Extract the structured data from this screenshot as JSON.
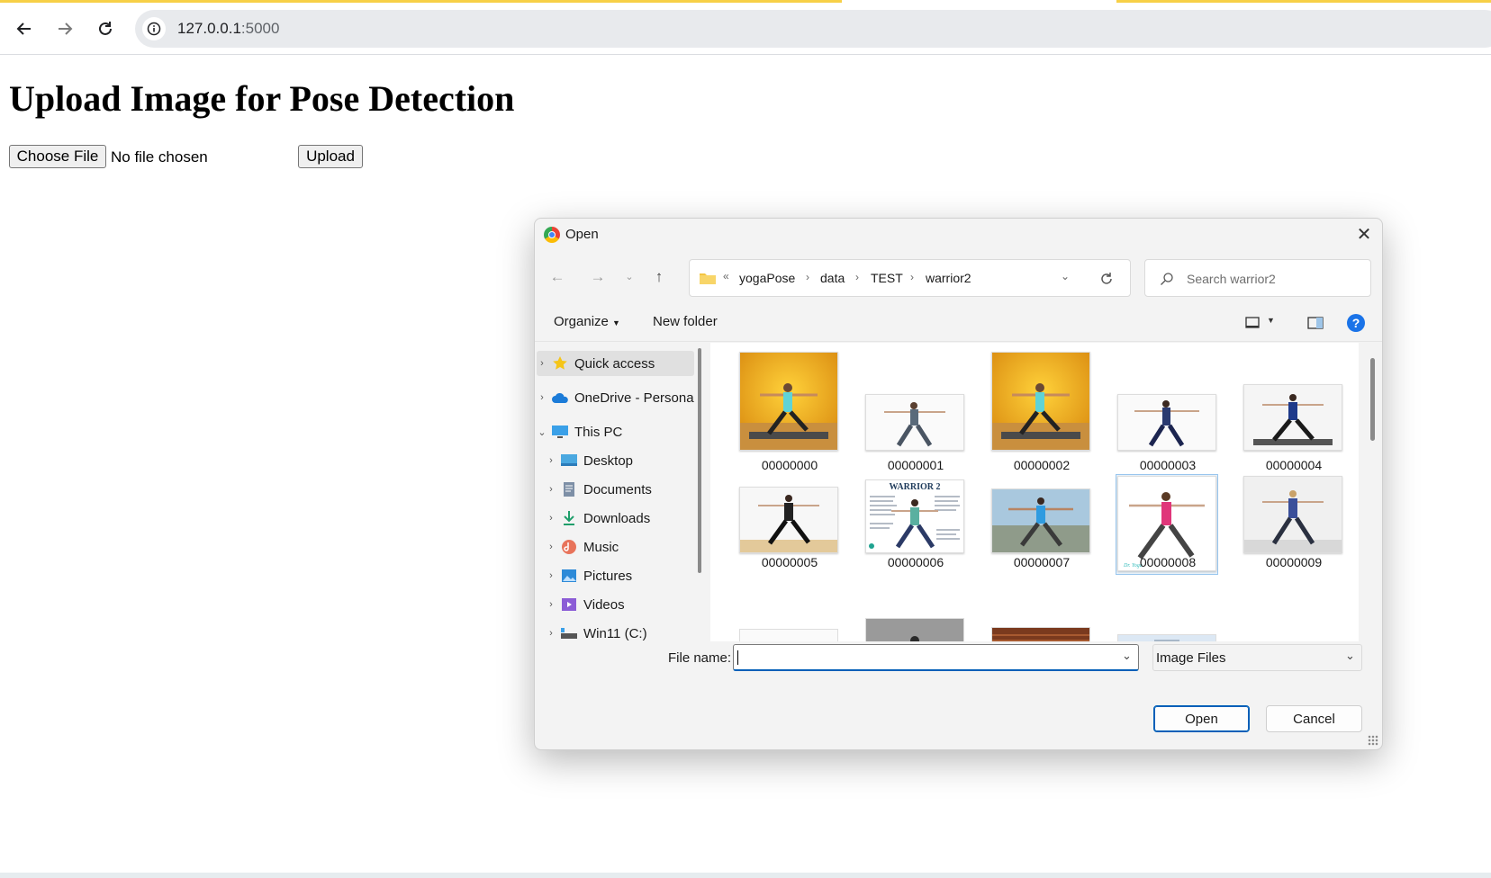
{
  "browser": {
    "url_host": "127.0.0.1",
    "url_port": ":5000",
    "accent_color": "#f7d047"
  },
  "page": {
    "heading": "Upload Image for Pose Detection",
    "choose_file_label": "Choose File",
    "file_status": "No file chosen",
    "upload_label": "Upload"
  },
  "dialog": {
    "title": "Open",
    "breadcrumb": {
      "overflow": "«",
      "path": [
        "yogaPose",
        "data",
        "TEST",
        "warrior2"
      ]
    },
    "search_placeholder": "Search warrior2",
    "commands": {
      "organize": "Organize",
      "new_folder": "New folder"
    },
    "sidebar": {
      "items": [
        {
          "label": "Quick access",
          "icon": "star-icon"
        },
        {
          "label": "OneDrive - Persona",
          "icon": "cloud-icon"
        },
        {
          "label": "This PC",
          "icon": "monitor-icon"
        },
        {
          "label": "Desktop",
          "icon": "desktop-icon"
        },
        {
          "label": "Documents",
          "icon": "document-icon"
        },
        {
          "label": "Downloads",
          "icon": "download-icon"
        },
        {
          "label": "Music",
          "icon": "music-icon"
        },
        {
          "label": "Pictures",
          "icon": "pictures-icon"
        },
        {
          "label": "Videos",
          "icon": "video-icon"
        },
        {
          "label": "Win11 (C:)",
          "icon": "drive-icon"
        }
      ]
    },
    "files": [
      {
        "name": "00000000"
      },
      {
        "name": "00000001"
      },
      {
        "name": "00000002"
      },
      {
        "name": "00000003"
      },
      {
        "name": "00000004"
      },
      {
        "name": "00000005"
      },
      {
        "name": "00000006",
        "thumb_text": "WARRIOR 2"
      },
      {
        "name": "00000007"
      },
      {
        "name": "00000008"
      },
      {
        "name": "00000009"
      }
    ],
    "file_name_label": "File name:",
    "file_name_value": "",
    "file_type": "Image Files",
    "open_label": "Open",
    "cancel_label": "Cancel",
    "primary_color": "#005fb8"
  }
}
